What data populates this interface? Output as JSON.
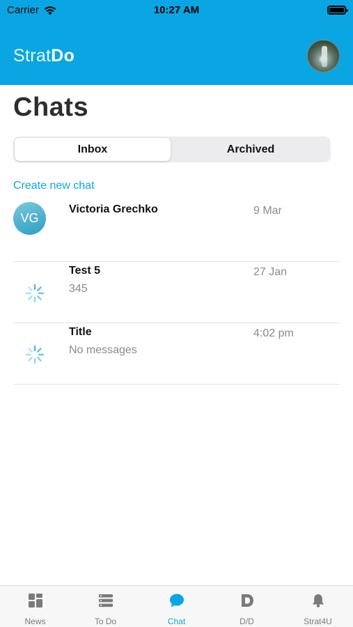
{
  "status_bar": {
    "carrier": "Carrier",
    "time": "10:27 AM"
  },
  "header": {
    "brand_light": "Strat",
    "brand_bold": "Do",
    "background_color": "#0aa6e3"
  },
  "page": {
    "title": "Chats",
    "create_link": "Create new chat"
  },
  "segments": {
    "inbox": "Inbox",
    "archived": "Archived",
    "selected": "Inbox"
  },
  "chats": [
    {
      "initials": "VG",
      "name": "Victoria Grechko",
      "preview": "",
      "date": "9 Mar",
      "avatar": "initials"
    },
    {
      "initials": "",
      "name": "Test 5",
      "preview": "345",
      "date": "27 Jan",
      "avatar": "spinner-icon"
    },
    {
      "initials": "",
      "name": "Title",
      "preview": "No messages",
      "date": "4:02 pm",
      "avatar": "spinner-icon"
    }
  ],
  "tabbar": {
    "items": [
      {
        "label": "News",
        "icon": "grid-icon"
      },
      {
        "label": "To Do",
        "icon": "list-icon"
      },
      {
        "label": "Chat",
        "icon": "chat-bubble-icon",
        "active": true
      },
      {
        "label": "D/D",
        "icon": "d-letter-icon"
      },
      {
        "label": "Strat4U",
        "icon": "bell-icon"
      }
    ]
  },
  "colors": {
    "accent": "#0aa6e3",
    "muted_text": "#8a8a8a",
    "tab_inactive": "#7a7a7a"
  }
}
